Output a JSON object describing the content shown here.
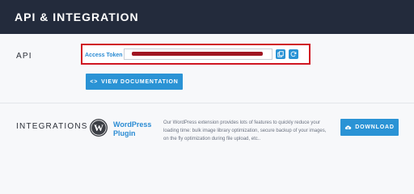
{
  "header": {
    "title": "API & INTEGRATION"
  },
  "api": {
    "section_label": "API",
    "token_label": "Access Token",
    "copy_icon": "copy-icon",
    "refresh_icon": "refresh-icon",
    "docs_button": "VIEW DOCUMENTATION",
    "docs_icon": "code-icon"
  },
  "integrations": {
    "section_label": "INTEGRATIONS",
    "plugin_icon": "wordpress-icon",
    "plugin_name": "WordPress Plugin",
    "plugin_description": "Our WordPress extension provides lots of features to quickly reduce your loading time: bulk image library optimization, secure backup of your images, on the fly optimization during file upload, etc..",
    "download_button": "DOWNLOAD",
    "download_icon": "cloud-download-icon"
  },
  "colors": {
    "header": "#232b3c",
    "accent": "#2a93d5",
    "highlight": "#d01622",
    "redaction": "#a01622"
  }
}
